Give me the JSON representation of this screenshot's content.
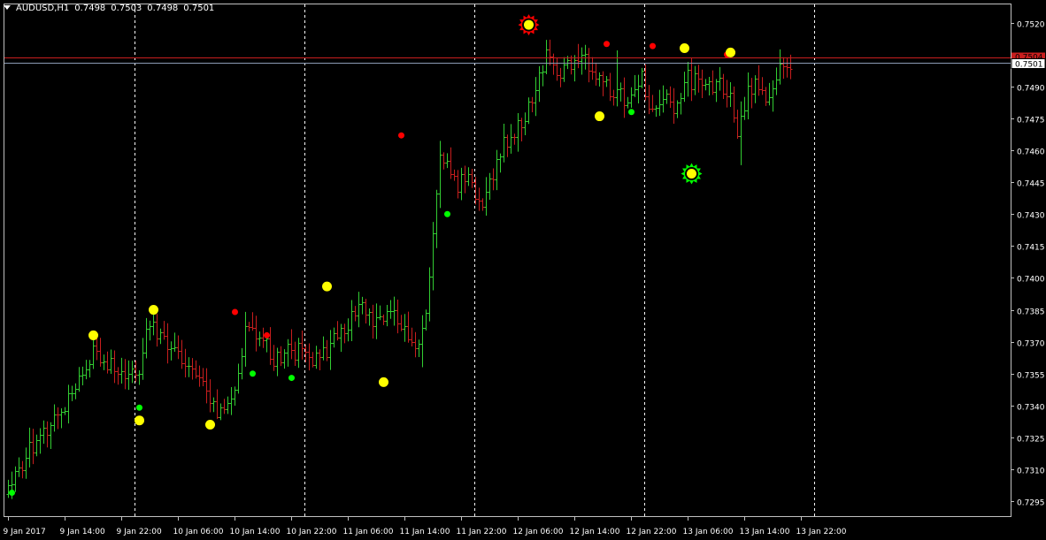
{
  "header": {
    "symbol": "AUDUSD,H1",
    "open": "0.7498",
    "high": "0.7503",
    "low": "0.7498",
    "close": "0.7501"
  },
  "colors": {
    "background": "#000000",
    "axis": "#c0c0c0",
    "text": "#ffffff",
    "bull": "#32cd32",
    "bear": "#c81e1e",
    "bid_line": "#c81e1e",
    "ask_line": "#8c9bb4",
    "pivot_yellow": "#ffff00",
    "pivot_red": "#ff0000",
    "pivot_green": "#00ff00"
  },
  "chart_data": {
    "type": "ohlc",
    "ylim": [
      0.7288,
      0.7529
    ],
    "y_ticks": [
      "0.7520",
      "0.7505",
      "0.7490",
      "0.7475",
      "0.7460",
      "0.7445",
      "0.7430",
      "0.7415",
      "0.7400",
      "0.7385",
      "0.7370",
      "0.7355",
      "0.7340",
      "0.7325",
      "0.7310",
      "0.7295"
    ],
    "x_ticks": [
      {
        "bar": 0,
        "label": "9 Jan 2017"
      },
      {
        "bar": 16,
        "label": "9 Jan 14:00"
      },
      {
        "bar": 32,
        "label": "9 Jan 22:00"
      },
      {
        "bar": 48,
        "label": "10 Jan 06:00"
      },
      {
        "bar": 64,
        "label": "10 Jan 14:00"
      },
      {
        "bar": 80,
        "label": "10 Jan 22:00"
      },
      {
        "bar": 96,
        "label": "11 Jan 06:00"
      },
      {
        "bar": 112,
        "label": "11 Jan 14:00"
      },
      {
        "bar": 128,
        "label": "11 Jan 22:00"
      },
      {
        "bar": 144,
        "label": "12 Jan 06:00"
      },
      {
        "bar": 160,
        "label": "12 Jan 14:00"
      },
      {
        "bar": 176,
        "label": "12 Jan 22:00"
      },
      {
        "bar": 192,
        "label": "13 Jan 06:00"
      },
      {
        "bar": 208,
        "label": "13 Jan 14:00"
      },
      {
        "bar": 224,
        "label": "13 Jan 22:00"
      }
    ],
    "day_separators": [
      36,
      84,
      132,
      180,
      228
    ],
    "bid_price": 0.75035,
    "ask_label": "0.7501",
    "bid_label": "0.7504",
    "anchors": [
      [
        0,
        0.7302
      ],
      [
        5,
        0.7316
      ],
      [
        11,
        0.733
      ],
      [
        18,
        0.7346
      ],
      [
        24,
        0.7365
      ],
      [
        28,
        0.736
      ],
      [
        33,
        0.7357
      ],
      [
        36,
        0.7353
      ],
      [
        40,
        0.7378
      ],
      [
        44,
        0.7369
      ],
      [
        48,
        0.7362
      ],
      [
        54,
        0.735
      ],
      [
        60,
        0.7337
      ],
      [
        64,
        0.7344
      ],
      [
        67,
        0.7378
      ],
      [
        71,
        0.7375
      ],
      [
        75,
        0.7362
      ],
      [
        80,
        0.7366
      ],
      [
        84,
        0.7364
      ],
      [
        88,
        0.7361
      ],
      [
        92,
        0.7372
      ],
      [
        96,
        0.738
      ],
      [
        100,
        0.7385
      ],
      [
        104,
        0.7379
      ],
      [
        108,
        0.7387
      ],
      [
        112,
        0.7378
      ],
      [
        116,
        0.7365
      ],
      [
        118,
        0.7387
      ],
      [
        120,
        0.7418
      ],
      [
        122,
        0.7458
      ],
      [
        126,
        0.7444
      ],
      [
        130,
        0.7446
      ],
      [
        134,
        0.7437
      ],
      [
        137,
        0.7447
      ],
      [
        140,
        0.7462
      ],
      [
        144,
        0.747
      ],
      [
        148,
        0.7483
      ],
      [
        152,
        0.7506
      ],
      [
        156,
        0.7496
      ],
      [
        160,
        0.7504
      ],
      [
        164,
        0.7502
      ],
      [
        168,
        0.7491
      ],
      [
        172,
        0.7486
      ],
      [
        176,
        0.7484
      ],
      [
        179,
        0.7494
      ],
      [
        181,
        0.7482
      ],
      [
        184,
        0.7484
      ],
      [
        188,
        0.7482
      ],
      [
        192,
        0.7494
      ],
      [
        196,
        0.749
      ],
      [
        200,
        0.7492
      ],
      [
        204,
        0.7485
      ],
      [
        206,
        0.7468
      ],
      [
        208,
        0.7481
      ],
      [
        210,
        0.7491
      ],
      [
        214,
        0.7487
      ],
      [
        218,
        0.7497
      ],
      [
        221,
        0.7501
      ]
    ],
    "spikes": [
      {
        "bar": 161,
        "high": 0.751
      },
      {
        "bar": 172,
        "high": 0.7507
      },
      {
        "bar": 181,
        "low": 0.7477
      },
      {
        "bar": 207,
        "low": 0.7453
      },
      {
        "bar": 117,
        "low": 0.7358
      }
    ],
    "pivots": [
      {
        "bar": 1,
        "price": 0.7299,
        "color": "green",
        "size": "small"
      },
      {
        "bar": 24,
        "price": 0.7373,
        "color": "yellow",
        "size": "big"
      },
      {
        "bar": 37,
        "price": 0.7339,
        "color": "green",
        "size": "small"
      },
      {
        "bar": 37,
        "price": 0.7333,
        "color": "yellow",
        "size": "big"
      },
      {
        "bar": 41,
        "price": 0.7385,
        "color": "yellow",
        "size": "big"
      },
      {
        "bar": 57,
        "price": 0.7331,
        "color": "yellow",
        "size": "big"
      },
      {
        "bar": 64,
        "price": 0.7384,
        "color": "red",
        "size": "small"
      },
      {
        "bar": 69,
        "price": 0.7355,
        "color": "green",
        "size": "small"
      },
      {
        "bar": 73,
        "price": 0.7373,
        "color": "red",
        "size": "small"
      },
      {
        "bar": 80,
        "price": 0.7353,
        "color": "green",
        "size": "small"
      },
      {
        "bar": 90,
        "price": 0.7396,
        "color": "yellow",
        "size": "big"
      },
      {
        "bar": 106,
        "price": 0.7351,
        "color": "yellow",
        "size": "big"
      },
      {
        "bar": 111,
        "price": 0.7467,
        "color": "red",
        "size": "small"
      },
      {
        "bar": 124,
        "price": 0.743,
        "color": "green",
        "size": "small"
      },
      {
        "bar": 147,
        "price": 0.7519,
        "color": "yellow",
        "size": "star-red"
      },
      {
        "bar": 167,
        "price": 0.7476,
        "color": "yellow",
        "size": "big"
      },
      {
        "bar": 169,
        "price": 0.751,
        "color": "red",
        "size": "small"
      },
      {
        "bar": 176,
        "price": 0.7478,
        "color": "green",
        "size": "small"
      },
      {
        "bar": 182,
        "price": 0.7509,
        "color": "red",
        "size": "small"
      },
      {
        "bar": 191,
        "price": 0.7508,
        "color": "yellow",
        "size": "big"
      },
      {
        "bar": 193,
        "price": 0.7449,
        "color": "yellow",
        "size": "star-green"
      },
      {
        "bar": 203,
        "price": 0.7505,
        "color": "red",
        "size": "small"
      },
      {
        "bar": 204,
        "price": 0.7506,
        "color": "yellow",
        "size": "big"
      }
    ]
  }
}
